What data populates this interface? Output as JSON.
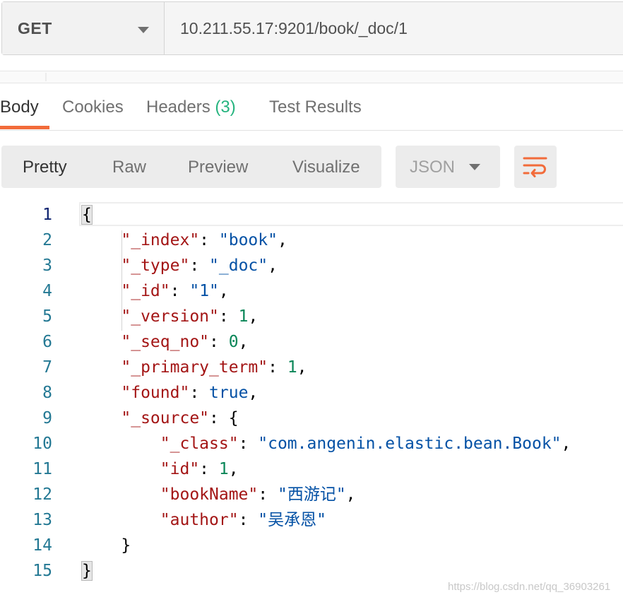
{
  "request": {
    "method": "GET",
    "url": "10.211.55.17:9201/book/_doc/1"
  },
  "response_tabs": [
    {
      "label": "Body",
      "count": ""
    },
    {
      "label": "Cookies",
      "count": ""
    },
    {
      "label": "Headers",
      "count": "(3)"
    },
    {
      "label": "Test Results",
      "count": ""
    }
  ],
  "view_modes": [
    "Pretty",
    "Raw",
    "Preview",
    "Visualize"
  ],
  "format": "JSON",
  "icons": {
    "method_dropdown": "chevron-down-icon",
    "format_dropdown": "chevron-down-icon",
    "wrap": "wrap-lines-icon"
  },
  "colors": {
    "accent": "#f26b3a",
    "count": "#26b47f",
    "json_key": "#a31515",
    "json_string": "#0451a5",
    "json_number": "#098658",
    "line_number": "#237893"
  },
  "code": {
    "line_numbers": [
      "1",
      "2",
      "3",
      "4",
      "5",
      "6",
      "7",
      "8",
      "9",
      "10",
      "11",
      "12",
      "13",
      "14",
      "15"
    ],
    "lines": [
      {
        "indent": "",
        "parts": [
          {
            "t": "{",
            "c": "brace-hl"
          }
        ]
      },
      {
        "indent": "    ",
        "parts": [
          {
            "t": "\"_index\"",
            "c": "key"
          },
          {
            "t": ": ",
            "c": ""
          },
          {
            "t": "\"book\"",
            "c": "str"
          },
          {
            "t": ",",
            "c": ""
          }
        ]
      },
      {
        "indent": "    ",
        "parts": [
          {
            "t": "\"_type\"",
            "c": "key"
          },
          {
            "t": ": ",
            "c": ""
          },
          {
            "t": "\"_doc\"",
            "c": "str"
          },
          {
            "t": ",",
            "c": ""
          }
        ]
      },
      {
        "indent": "    ",
        "parts": [
          {
            "t": "\"_id\"",
            "c": "key"
          },
          {
            "t": ": ",
            "c": ""
          },
          {
            "t": "\"1\"",
            "c": "str"
          },
          {
            "t": ",",
            "c": ""
          }
        ]
      },
      {
        "indent": "    ",
        "parts": [
          {
            "t": "\"_version\"",
            "c": "key"
          },
          {
            "t": ": ",
            "c": ""
          },
          {
            "t": "1",
            "c": "num"
          },
          {
            "t": ",",
            "c": ""
          }
        ]
      },
      {
        "indent": "    ",
        "parts": [
          {
            "t": "\"_seq_no\"",
            "c": "key"
          },
          {
            "t": ": ",
            "c": ""
          },
          {
            "t": "0",
            "c": "num"
          },
          {
            "t": ",",
            "c": ""
          }
        ]
      },
      {
        "indent": "    ",
        "parts": [
          {
            "t": "\"_primary_term\"",
            "c": "key"
          },
          {
            "t": ": ",
            "c": ""
          },
          {
            "t": "1",
            "c": "num"
          },
          {
            "t": ",",
            "c": ""
          }
        ]
      },
      {
        "indent": "    ",
        "parts": [
          {
            "t": "\"found\"",
            "c": "key"
          },
          {
            "t": ": ",
            "c": ""
          },
          {
            "t": "true",
            "c": "kw"
          },
          {
            "t": ",",
            "c": ""
          }
        ]
      },
      {
        "indent": "    ",
        "parts": [
          {
            "t": "\"_source\"",
            "c": "key"
          },
          {
            "t": ": {",
            "c": ""
          }
        ]
      },
      {
        "indent": "        ",
        "parts": [
          {
            "t": "\"_class\"",
            "c": "key"
          },
          {
            "t": ": ",
            "c": ""
          },
          {
            "t": "\"com.angenin.elastic.bean.Book\"",
            "c": "str"
          },
          {
            "t": ",",
            "c": ""
          }
        ]
      },
      {
        "indent": "        ",
        "parts": [
          {
            "t": "\"id\"",
            "c": "key"
          },
          {
            "t": ": ",
            "c": ""
          },
          {
            "t": "1",
            "c": "num"
          },
          {
            "t": ",",
            "c": ""
          }
        ]
      },
      {
        "indent": "        ",
        "parts": [
          {
            "t": "\"bookName\"",
            "c": "key"
          },
          {
            "t": ": ",
            "c": ""
          },
          {
            "t": "\"西游记\"",
            "c": "str"
          },
          {
            "t": ",",
            "c": ""
          }
        ]
      },
      {
        "indent": "        ",
        "parts": [
          {
            "t": "\"author\"",
            "c": "key"
          },
          {
            "t": ": ",
            "c": ""
          },
          {
            "t": "\"吴承恩\"",
            "c": "str"
          }
        ]
      },
      {
        "indent": "    ",
        "parts": [
          {
            "t": "}",
            "c": ""
          }
        ]
      },
      {
        "indent": "",
        "parts": [
          {
            "t": "}",
            "c": "brace-hl"
          }
        ]
      }
    ]
  },
  "watermark": "https://blog.csdn.net/qq_36903261"
}
